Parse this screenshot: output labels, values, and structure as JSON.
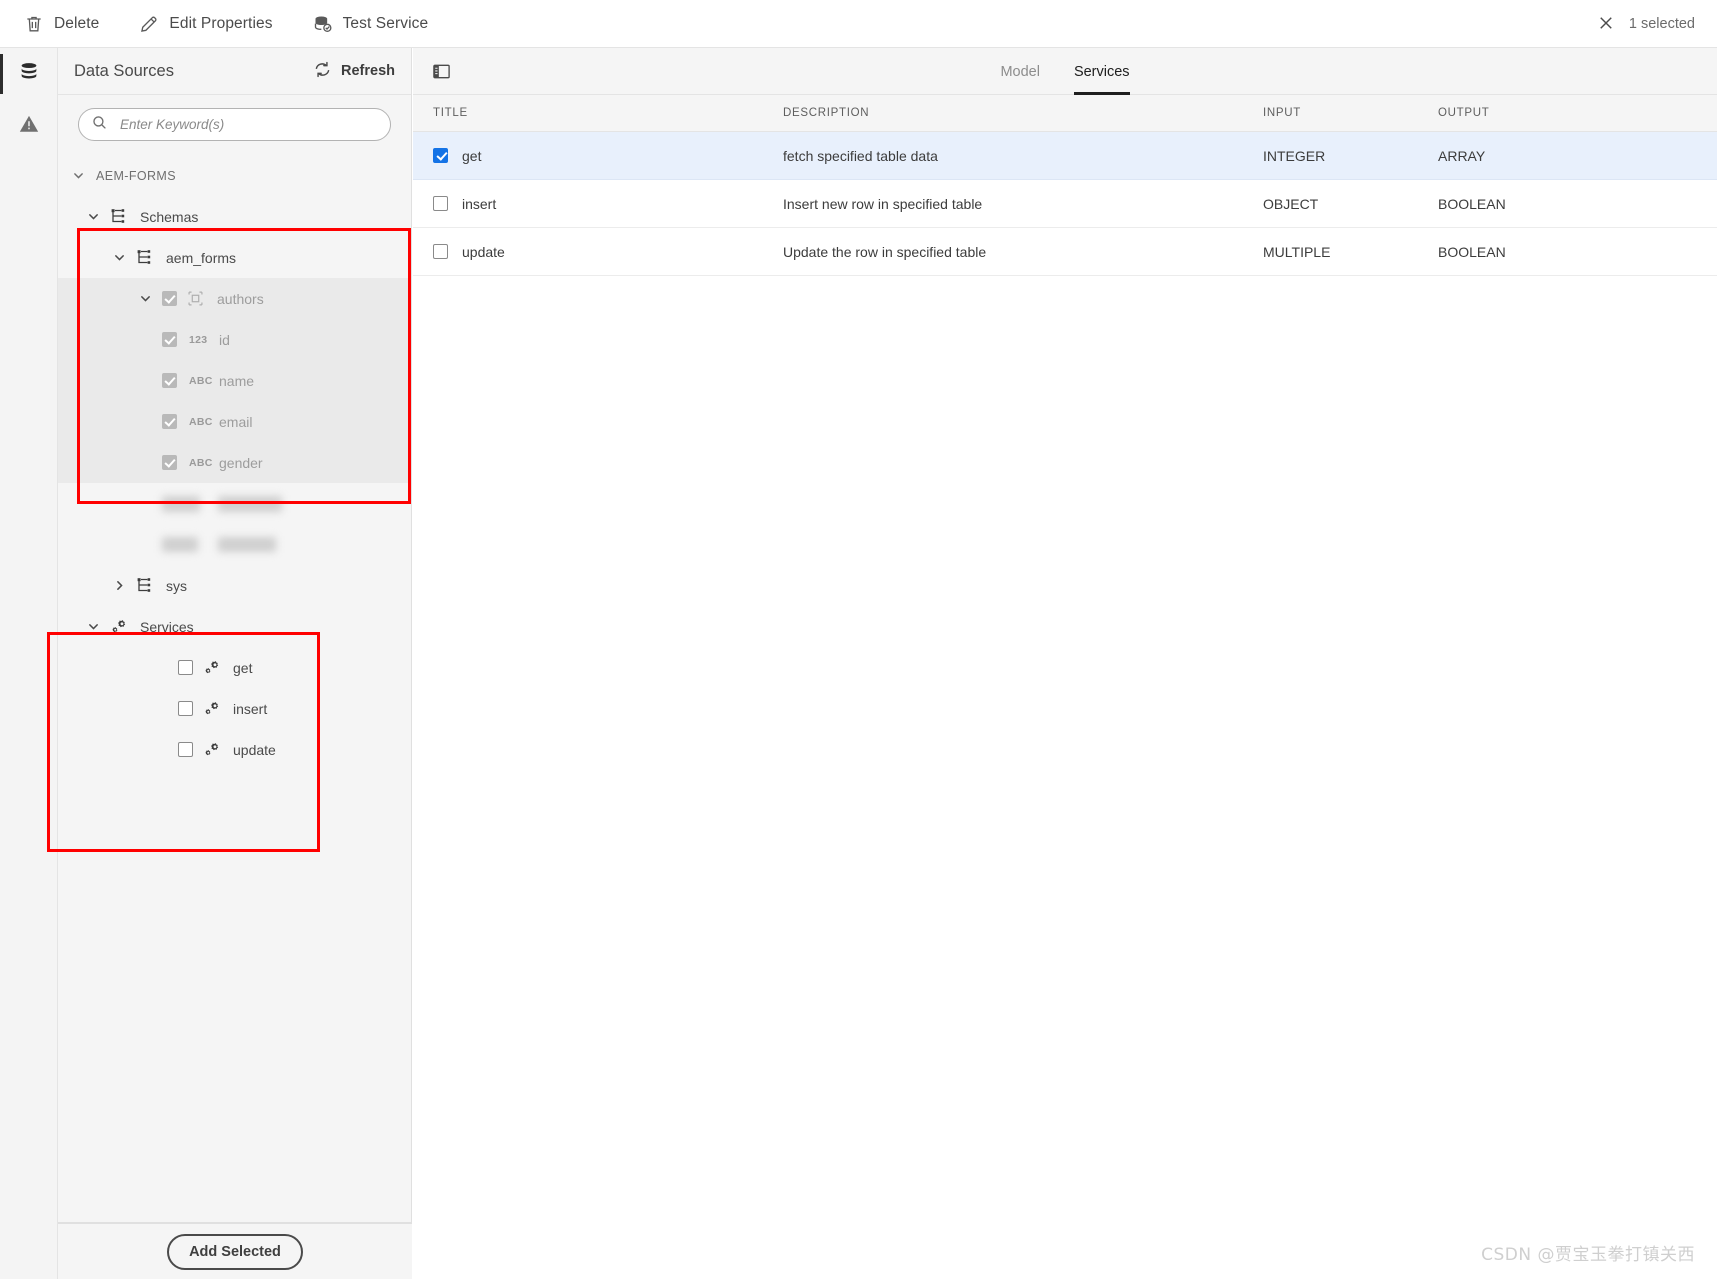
{
  "toolbar": {
    "buttons": [
      {
        "label": "Delete",
        "icon": "trash-icon"
      },
      {
        "label": "Edit Properties",
        "icon": "pencil-icon"
      },
      {
        "label": "Test Service",
        "icon": "database-check-icon"
      }
    ],
    "selection_text": "1 selected",
    "close_icon": "close-icon"
  },
  "rail": {
    "items": [
      {
        "icon": "database-icon",
        "active": true
      },
      {
        "icon": "warning-triangle-icon",
        "active": false
      }
    ]
  },
  "data_sources": {
    "title": "Data Sources",
    "refresh_label": "Refresh",
    "refresh_icon": "refresh-icon",
    "search": {
      "placeholder": "Enter Keyword(s)",
      "value": "",
      "icon": "search-icon"
    },
    "group_label": "AEM-FORMS",
    "schemas_label": "Schemas",
    "schema_name": "aem_forms",
    "table_name": "authors",
    "columns": [
      {
        "label": "id",
        "type": "123"
      },
      {
        "label": "name",
        "type": "ABC"
      },
      {
        "label": "email",
        "type": "ABC"
      },
      {
        "label": "gender",
        "type": "ABC"
      }
    ],
    "sys_label": "sys",
    "services_label": "Services",
    "services": [
      {
        "label": "get",
        "checked": false
      },
      {
        "label": "insert",
        "checked": false
      },
      {
        "label": "update",
        "checked": false
      }
    ],
    "add_selected_label": "Add Selected"
  },
  "main": {
    "panel_toggle_icon": "panel-toggle-icon",
    "tabs": [
      {
        "label": "Model",
        "active": false
      },
      {
        "label": "Services",
        "active": true
      }
    ],
    "table": {
      "headers": [
        "TITLE",
        "DESCRIPTION",
        "INPUT",
        "OUTPUT"
      ],
      "rows": [
        {
          "title": "get",
          "description": "fetch specified table data",
          "input": "INTEGER",
          "output": "ARRAY",
          "checked": true,
          "selected": true
        },
        {
          "title": "insert",
          "description": "Insert new row in specified table",
          "input": "OBJECT",
          "output": "BOOLEAN",
          "checked": false,
          "selected": false
        },
        {
          "title": "update",
          "description": "Update the row in specified table",
          "input": "MULTIPLE",
          "output": "BOOLEAN",
          "checked": false,
          "selected": false
        }
      ]
    }
  },
  "watermark": "CSDN @贾宝玉拳打镇关西",
  "colors": {
    "accent": "#1473e6",
    "selected_row": "#e8f0fc",
    "annotation": "#ff0000",
    "panel_bg": "#f5f5f5"
  }
}
